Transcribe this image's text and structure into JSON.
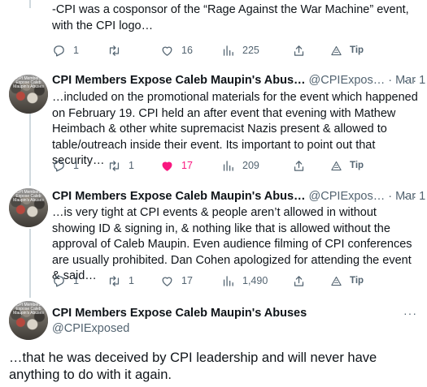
{
  "colors": {
    "text": "#0f1419",
    "muted": "#536471",
    "like": "#f91880",
    "thread_line": "#cfd9de"
  },
  "tweet_top": {
    "text": "-CPI was a cosponsor of the “Rage Against the War Machine” event, with the CPI logo…",
    "stats": {
      "replies": "1",
      "retweets": "",
      "likes": "16",
      "views": "225",
      "tip": "Tip"
    }
  },
  "tweet_2": {
    "name": "CPI Members Expose Caleb Maupin's Abus…",
    "handle": "@CPIExpos…",
    "dot": "·",
    "date": "Mar 1",
    "text": "…included on the promotional materials for the event which happened on February 19. CPI held an after event that evening with Mathew Heimbach & other white supremacist Nazis present & allowed to table/outreach inside their event. Its important to point out that security…",
    "stats": {
      "replies": "1",
      "retweets": "1",
      "likes": "17",
      "views": "209",
      "tip": "Tip"
    }
  },
  "tweet_3": {
    "name": "CPI Members Expose Caleb Maupin's Abus…",
    "handle": "@CPIExpos…",
    "dot": "·",
    "date": "Mar 1",
    "text": "…is very tight at CPI events & people aren’t allowed in without showing ID & signing in, & nothing like that is allowed without the approval of Caleb Maupin. Even audience filming of CPI conferences are usually prohibited. Dan Cohen apologized for attending the event & said…",
    "stats": {
      "replies": "1",
      "retweets": "1",
      "likes": "17",
      "views": "1,490",
      "tip": "Tip"
    }
  },
  "tweet_4": {
    "name": "CPI Members Expose Caleb Maupin's Abuses",
    "handle": "@CPIExposed",
    "text": "…that he was deceived by CPI leadership and will never have anything to do with it again."
  },
  "avatar_caption": "CPI Members Expose Caleb Maupin's Abuses",
  "more_glyph": "···",
  "icons": [
    "reply-icon",
    "retweet-icon",
    "heart-icon",
    "views-icon",
    "share-icon",
    "tip-icon",
    "more-icon"
  ]
}
